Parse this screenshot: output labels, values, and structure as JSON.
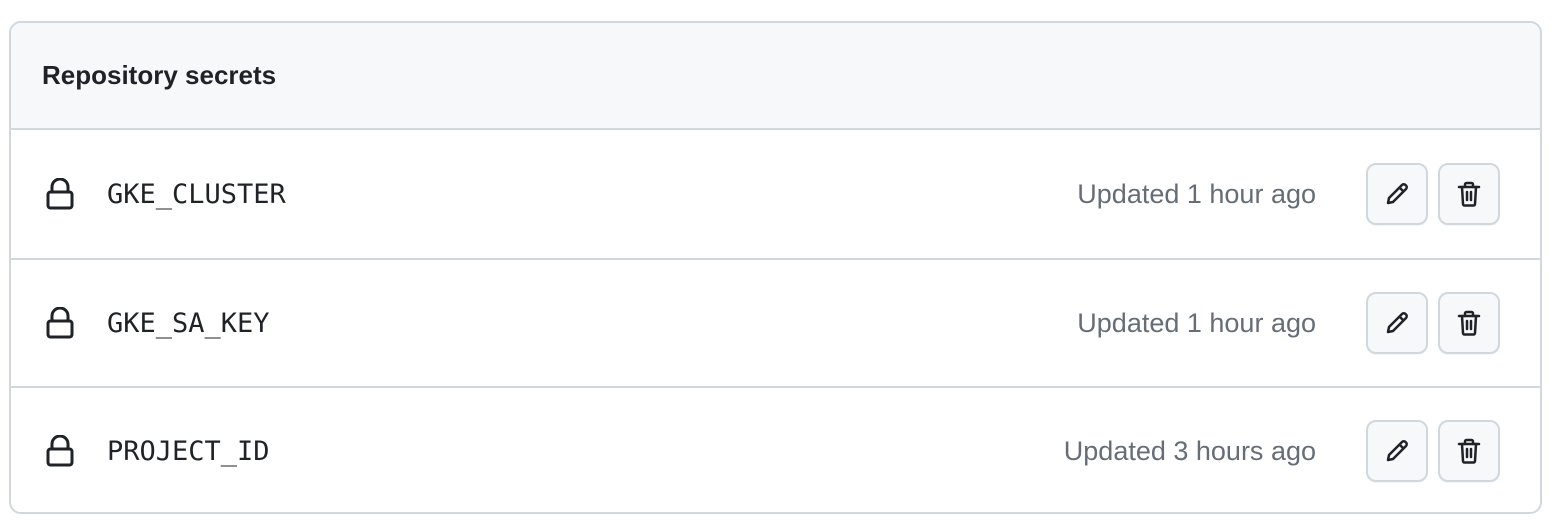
{
  "section": {
    "title": "Repository secrets"
  },
  "secrets": [
    {
      "name": "GKE_CLUSTER",
      "updated": "Updated 1 hour ago"
    },
    {
      "name": "GKE_SA_KEY",
      "updated": "Updated 1 hour ago"
    },
    {
      "name": "PROJECT_ID",
      "updated": "Updated 3 hours ago"
    }
  ],
  "icons": {
    "row_icon": "lock-icon",
    "edit": "pencil-icon",
    "delete": "trash-icon"
  },
  "colors": {
    "text_primary": "#1f2328",
    "text_muted": "#656d76",
    "border": "#d0d7de",
    "header_bg": "#f6f8fa"
  }
}
